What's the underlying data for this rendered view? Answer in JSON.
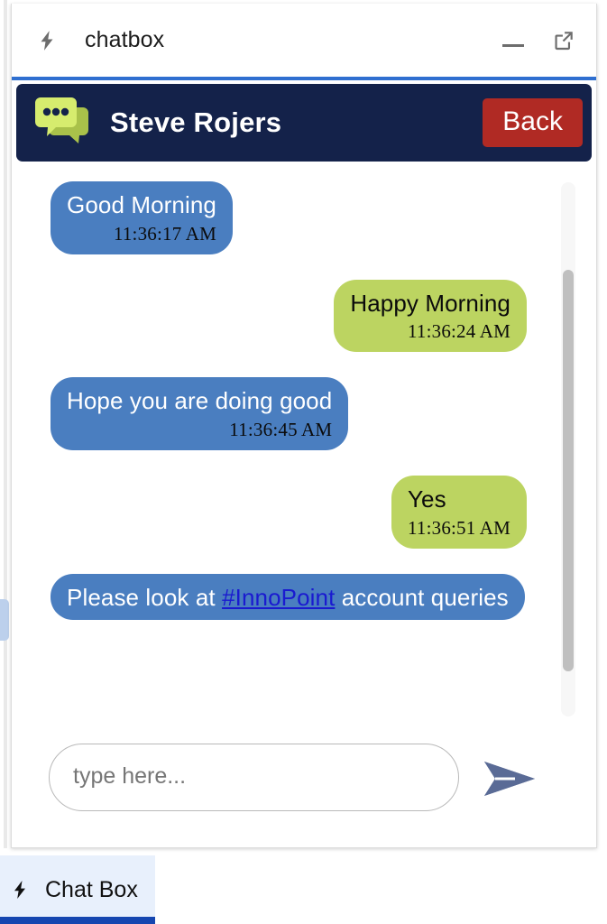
{
  "window": {
    "title": "chatbox",
    "bolt_icon": "bolt-icon",
    "minimize_label": "Minimize",
    "expand_label": "Open in new window"
  },
  "chat_header": {
    "avatar_icon": "chat-bubbles-icon",
    "contact_name": "Steve Rojers",
    "back_label": "Back",
    "background_color": "#14224a",
    "back_color": "#b02a24"
  },
  "messages": [
    {
      "direction": "incoming",
      "text": "Good Morning",
      "time": "11:36:17 AM"
    },
    {
      "direction": "outgoing",
      "text": "Happy Morning",
      "time": "11:36:24 AM"
    },
    {
      "direction": "incoming",
      "text": "Hope you are doing good",
      "time": "11:36:45 AM"
    },
    {
      "direction": "outgoing",
      "text": "Yes",
      "time": "11:36:51 AM"
    },
    {
      "direction": "incoming",
      "text_before": "Please look at ",
      "hashtag": "#InnoPoint",
      "text_after": " account queries",
      "time": ""
    }
  ],
  "colors": {
    "incoming_bubble": "#4a7ec0",
    "outgoing_bubble": "#bcd461",
    "hashtag_link": "#1a1ad0",
    "accent_divider": "#2f6fd0",
    "taskbar_active": "#e8f0fc",
    "taskbar_underline": "#1546b0"
  },
  "composer": {
    "placeholder": "type here...",
    "value": "",
    "send_icon": "send-paper-plane-icon"
  },
  "scrollbar": {
    "name": "messages-scrollbar"
  },
  "taskbar": {
    "item_label": "Chat Box",
    "bolt_icon": "bolt-icon"
  }
}
